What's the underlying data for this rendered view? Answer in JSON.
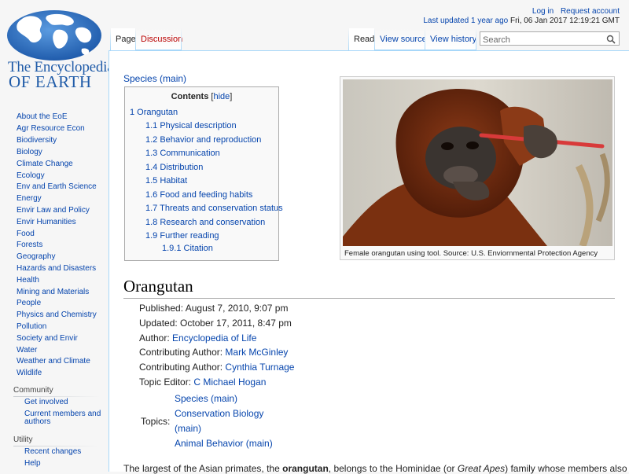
{
  "logo": {
    "line1": "The Encyclopedia",
    "line2": "OF EARTH",
    "colors": {
      "ocean": "#2d6fc2",
      "land": "#ffffff",
      "text": "#1f5ba8"
    }
  },
  "personal": {
    "login": "Log in",
    "request_account": "Request account",
    "last_updated_link": "Last updated 1 year ago",
    "last_updated_date": "Fri, 06 Jan 2017 12:19:21 GMT"
  },
  "tabs": {
    "left": [
      "Page",
      "Discussion"
    ],
    "right": [
      "Read",
      "View source",
      "View history"
    ]
  },
  "search": {
    "placeholder": "Search"
  },
  "sidebar": {
    "nav": [
      "About the EoE",
      "Agr Resource Econ",
      "Biodiversity",
      "Biology",
      "Climate Change",
      "Ecology",
      "Env and Earth Science",
      "Energy",
      "Envir Law and Policy",
      "Envir Humanities",
      "Food",
      "Forests",
      "Geography",
      "Hazards and Disasters",
      "Health",
      "Mining and Materials",
      "People",
      "Physics and Chemistry",
      "Pollution",
      "Society and Envir",
      "Water",
      "Weather and Climate",
      "Wildlife"
    ],
    "community": {
      "heading": "Community",
      "items": [
        "Get involved",
        "Current members and authors"
      ]
    },
    "utility": {
      "heading": "Utility",
      "items": [
        "Recent changes",
        "Help"
      ]
    }
  },
  "content": {
    "species_link": "Species (main)",
    "toc": {
      "title": "Contents",
      "hide_open": "[",
      "hide": "hide",
      "hide_close": "]",
      "items": [
        "1 Orangutan",
        "1.1 Physical description",
        "1.2 Behavior and reproduction",
        "1.3 Communication",
        "1.4 Distribution",
        "1.5 Habitat",
        "1.6 Food and feeding habits",
        "1.7 Threats and conservation status",
        "1.8 Research and conservation",
        "1.9 Further reading",
        "1.9.1 Citation"
      ]
    },
    "image_caption": "Female orangutan using tool. Source: U.S. Enviornmental Protection Agency",
    "title": "Orangutan",
    "meta": {
      "published": "Published: August 7, 2010, 9:07 pm",
      "updated": "Updated: October 17, 2011, 8:47 pm",
      "author_label": "Author: ",
      "author": "Encyclopedia of Life",
      "contrib_label": "Contributing Author: ",
      "contrib1": "Mark McGinley",
      "contrib2": "Cynthia Turnage",
      "editor_label": "Topic Editor: ",
      "editor": "C Michael Hogan",
      "topics_label": "Topics:",
      "topics": [
        "Species (main)",
        "Conservation Biology",
        "(main)",
        "Animal Behavior (main)"
      ]
    },
    "body": {
      "t1": "The largest of the Asian primates, the ",
      "b1": "orangutan",
      "t2": ", belongs to the Hominidae (or ",
      "i1": "Great Apes",
      "t3": ") family whose members also include"
    }
  }
}
